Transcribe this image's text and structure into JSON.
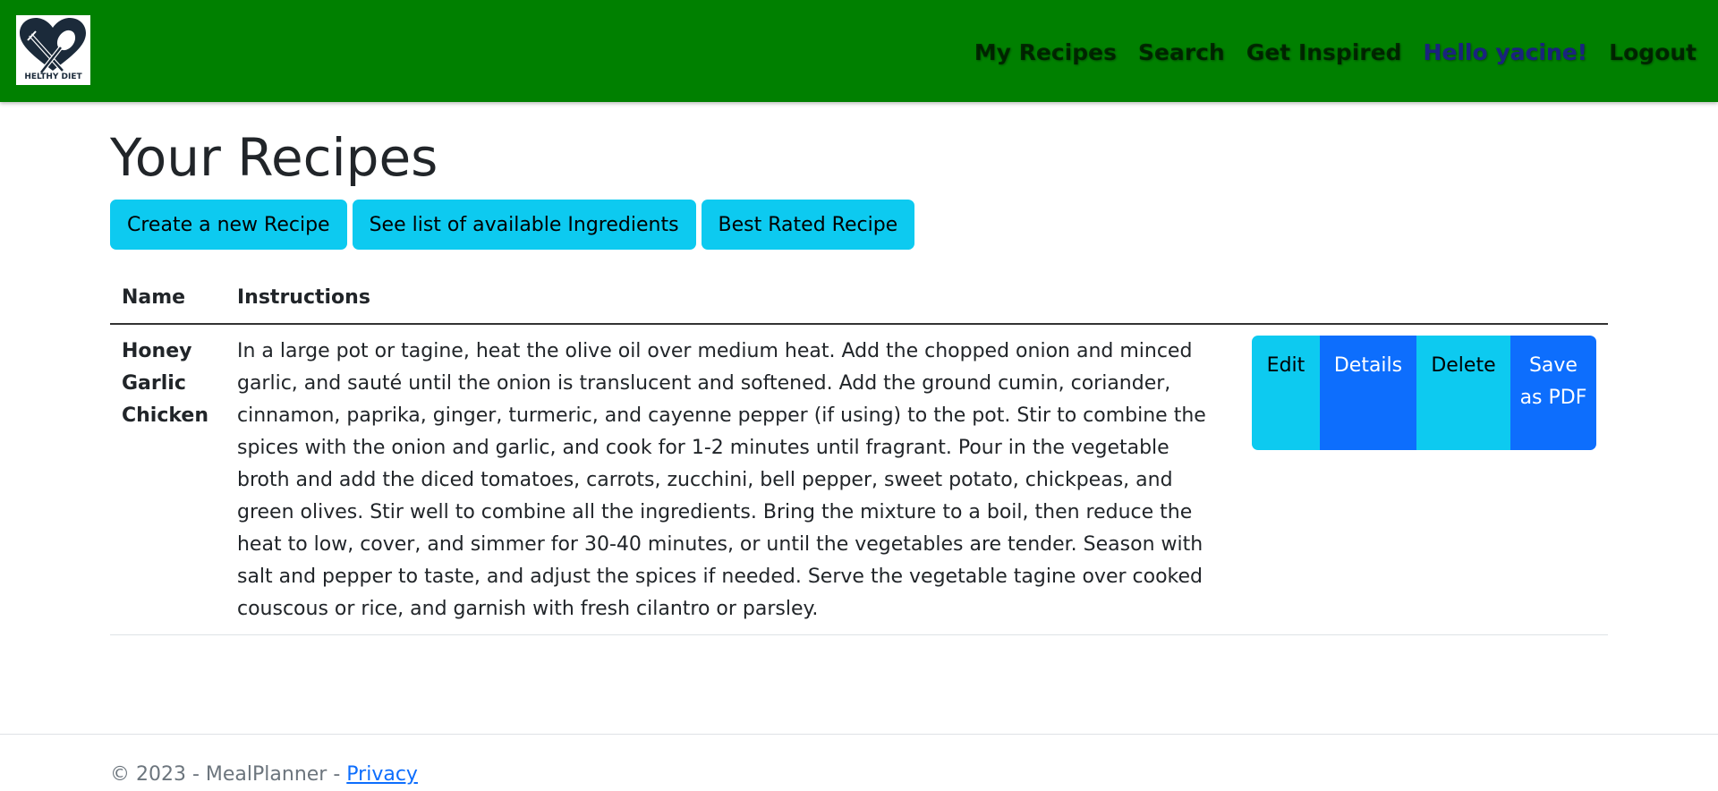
{
  "brand": {
    "logo_text": "HELTHY DIET",
    "icon": "heart-fork-spoon-icon"
  },
  "nav": {
    "items": [
      {
        "label": "My Recipes"
      },
      {
        "label": "Search"
      },
      {
        "label": "Get Inspired"
      },
      {
        "label": "Hello yacine!"
      },
      {
        "label": "Logout"
      }
    ]
  },
  "main": {
    "title": "Your Recipes",
    "buttons": {
      "create": "Create a new Recipe",
      "ingredients": "See list of available Ingredients",
      "best_rated": "Best Rated Recipe"
    },
    "table": {
      "headers": {
        "name": "Name",
        "instructions": "Instructions"
      },
      "rows": [
        {
          "name": "Honey Garlic Chicken",
          "instructions": "In a large pot or tagine, heat the olive oil over medium heat. Add the chopped onion and minced garlic, and sauté until the onion is translucent and softened. Add the ground cumin, coriander, cinnamon, paprika, ginger, turmeric, and cayenne pepper (if using) to the pot. Stir to combine the spices with the onion and garlic, and cook for 1-2 minutes until fragrant. Pour in the vegetable broth and add the diced tomatoes, carrots, zucchini, bell pepper, sweet potato, chickpeas, and green olives. Stir well to combine all the ingredients. Bring the mixture to a boil, then reduce the heat to low, cover, and simmer for 30-40 minutes, or until the vegetables are tender. Season with salt and pepper to taste, and adjust the spices if needed. Serve the vegetable tagine over cooked couscous or rice, and garnish with fresh cilantro or parsley.",
          "actions": {
            "edit": "Edit",
            "details": "Details",
            "delete": "Delete",
            "pdf": "Save as PDF"
          }
        }
      ]
    }
  },
  "footer": {
    "text": "© 2023 - MealPlanner - ",
    "privacy": "Privacy"
  },
  "colors": {
    "navbar": "#008000",
    "info": "#0dcaf0",
    "primary": "#0d6efd",
    "greeting": "#1a237e"
  }
}
